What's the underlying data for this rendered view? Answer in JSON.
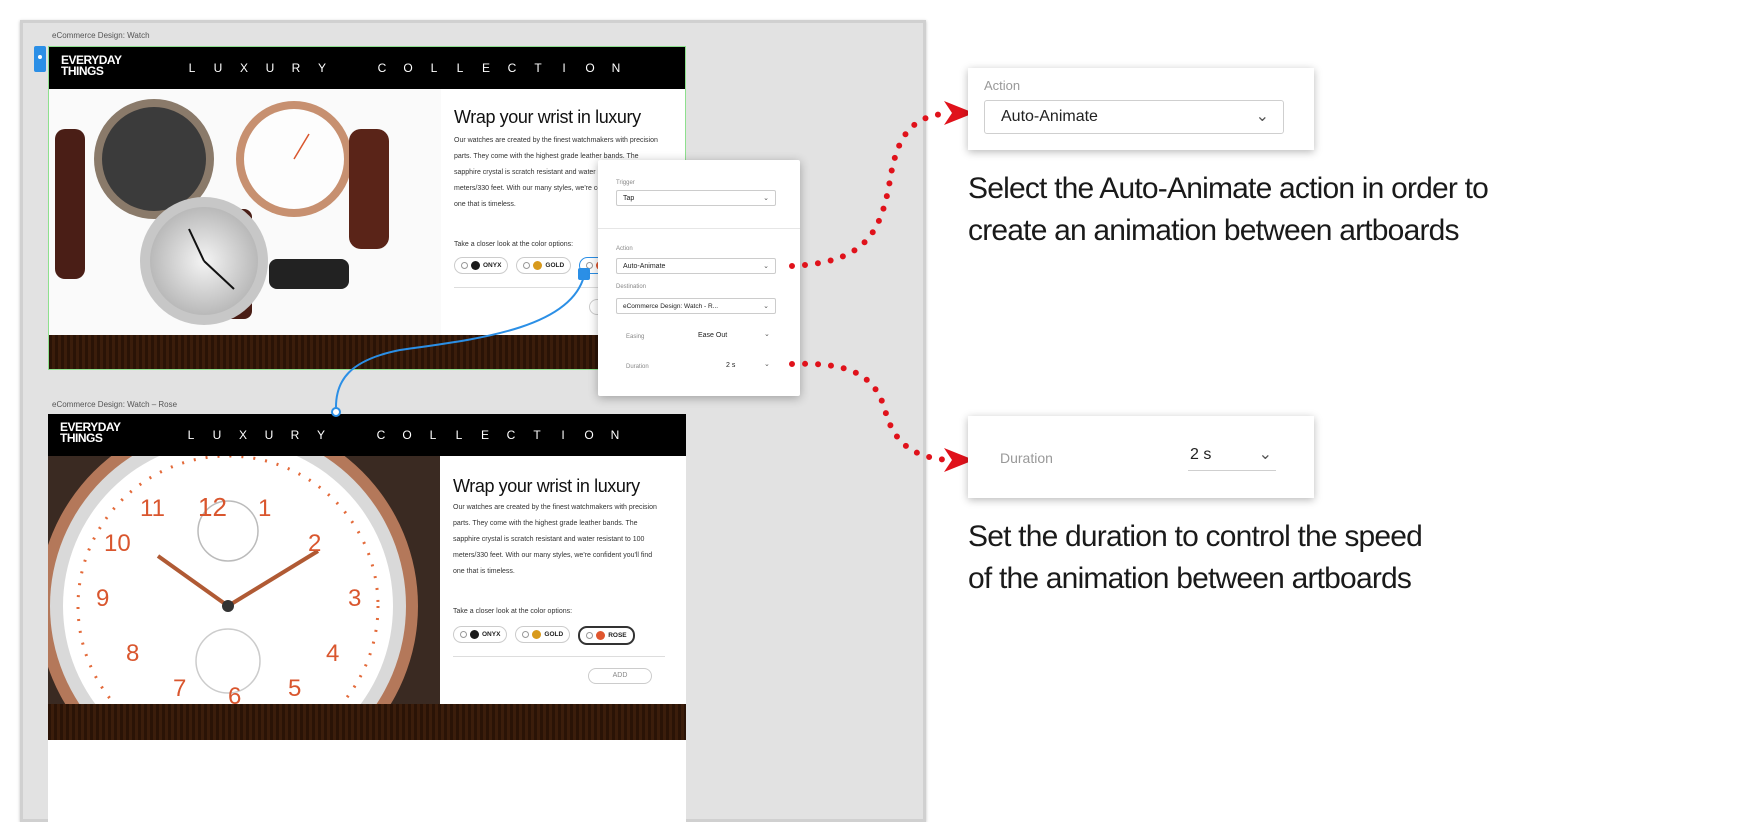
{
  "canvas": {
    "artboard1_label": "eCommerce Design: Watch",
    "artboard2_label": "eCommerce Design: Watch – Rose"
  },
  "artboard": {
    "logo_line1": "EVERYDAY",
    "logo_line2": "THINGS",
    "banner_word1": [
      "L",
      "U",
      "X",
      "U",
      "R",
      "Y"
    ],
    "banner_word2": [
      "C",
      "O",
      "L",
      "L",
      "E",
      "C",
      "T",
      "I",
      "O",
      "N"
    ],
    "title": "Wrap your wrist in luxury",
    "body": "Our watches are created by the finest watchmakers with precision parts. They come with the highest grade leather bands. The sapphire crystal is scratch resistant and water resistant to 100 meters/330 feet. With our many styles, we're confident you'll find one that is timeless.",
    "swatch_prompt": "Take a closer look at the color options:",
    "swatches": [
      "ONYX",
      "GOLD",
      "ROSE"
    ],
    "add_label": "ADD"
  },
  "panel": {
    "trigger_label": "Trigger",
    "trigger_value": "Tap",
    "action_label": "Action",
    "action_value": "Auto-Animate",
    "destination_label": "Destination",
    "destination_value": "eCommerce Design: Watch - R...",
    "easing_label": "Easing",
    "easing_value": "Ease Out",
    "duration_label": "Duration",
    "duration_value": "2 s"
  },
  "callout_action": {
    "label": "Action",
    "value": "Auto-Animate"
  },
  "callout_duration": {
    "label": "Duration",
    "value": "2 s"
  },
  "captions": {
    "action_line1": "Select the Auto-Animate action in order to",
    "action_line2": "create an animation between artboards",
    "duration_line1": "Set the duration to control the speed",
    "duration_line2": "of the animation between artboards"
  },
  "colors": {
    "arrow_red": "#e0121b",
    "wire_blue": "#2b8fe6",
    "onyx": "#1b1b1b",
    "gold": "#d89a1c",
    "rose": "#e0562e"
  }
}
